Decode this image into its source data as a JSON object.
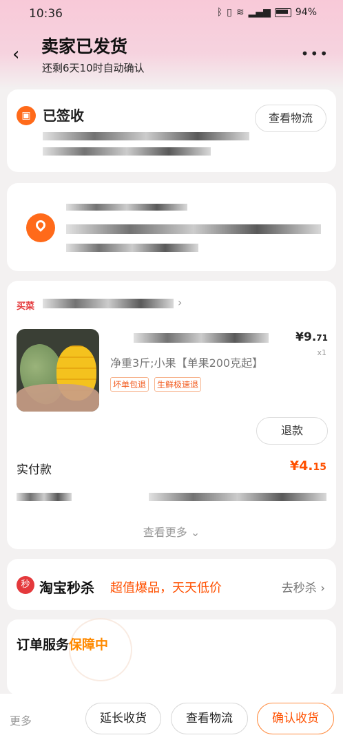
{
  "status_bar": {
    "time": "10:36",
    "battery": "94%"
  },
  "header": {
    "back_icon": "‹",
    "title": "卖家已发货",
    "subtitle": "还剩6天10时自动确认",
    "more_icon": "•••"
  },
  "logistics": {
    "status": "已签收",
    "button": "查看物流"
  },
  "product": {
    "shop_logo_text": "买菜",
    "price_main": "¥9.",
    "price_decimal": "71",
    "quantity": "x1",
    "spec": "净重3斤;小果【单果200克起】",
    "tags": [
      "坏单包退",
      "生鲜极速退"
    ],
    "refund_button": "退款",
    "paid_label": "实付款",
    "paid_main": "¥4.",
    "paid_decimal": "15",
    "see_more": "查看更多",
    "see_more_icon": "⌄"
  },
  "seckill": {
    "icon_text": "秒",
    "title": "淘宝秒杀",
    "slogan": "超值爆品，天天低价",
    "link": "去秒杀"
  },
  "service": {
    "title_prefix": "订单服务",
    "title_highlight": "保障中"
  },
  "bottom_bar": {
    "more": "更多",
    "extend": "延长收货",
    "logistics": "查看物流",
    "confirm": "确认收货"
  },
  "colors": {
    "accent": "#ff5000",
    "header_bg": "#f8c9d8",
    "page_bg": "#f3f1f1"
  }
}
